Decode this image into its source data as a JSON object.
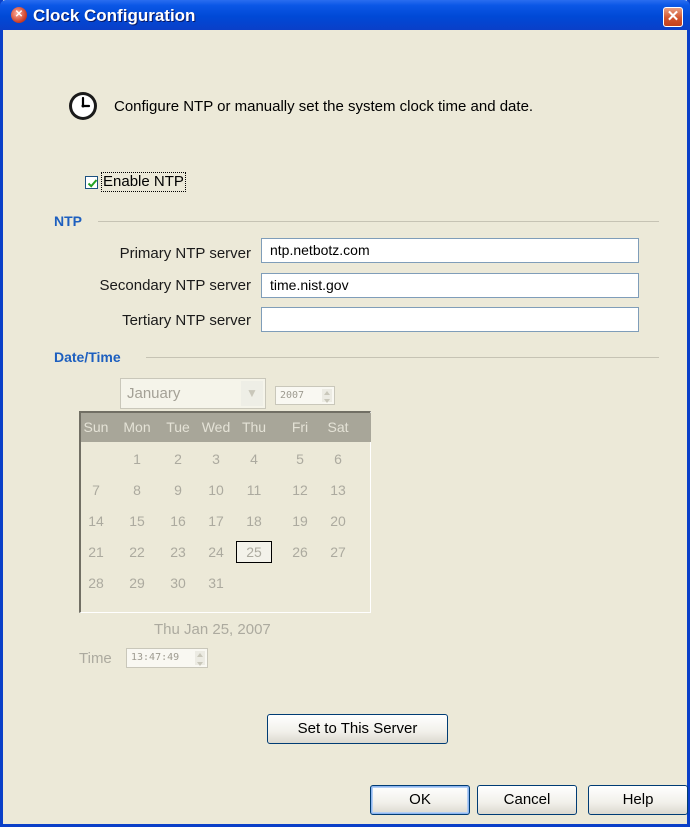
{
  "window": {
    "title": "Clock Configuration",
    "close_glyph": "✕",
    "app_icon": "netbotz-app-icon"
  },
  "intro": {
    "icon": "clock-icon",
    "text": "Configure NTP or manually set the system clock time and date."
  },
  "enable_ntp": {
    "label": "Enable NTP",
    "checked": true
  },
  "ntp": {
    "section_title": "NTP",
    "fields": [
      {
        "label": "Primary NTP server",
        "value": "ntp.netbotz.com"
      },
      {
        "label": "Secondary NTP server",
        "value": "time.nist.gov"
      },
      {
        "label": "Tertiary NTP server",
        "value": ""
      }
    ]
  },
  "datetime": {
    "section_title": "Date/Time",
    "month": "January",
    "year": "2007",
    "weekdays": [
      "Sun",
      "Mon",
      "Tue",
      "Wed",
      "Thu",
      "Fri",
      "Sat"
    ],
    "weeks": [
      [
        "",
        "1",
        "2",
        "3",
        "4",
        "5",
        "6"
      ],
      [
        "7",
        "8",
        "9",
        "10",
        "11",
        "12",
        "13"
      ],
      [
        "14",
        "15",
        "16",
        "17",
        "18",
        "19",
        "20"
      ],
      [
        "21",
        "22",
        "23",
        "24",
        "25",
        "26",
        "27"
      ],
      [
        "28",
        "29",
        "30",
        "31",
        "",
        "",
        ""
      ]
    ],
    "selected_day": "25",
    "date_caption": "Thu Jan 25, 2007",
    "time_label": "Time",
    "time_value": "13:47:49",
    "enabled": false,
    "disabled_color": "#acaa9f"
  },
  "buttons": {
    "set_server": "Set to This Server",
    "ok": "OK",
    "cancel": "Cancel",
    "help": "Help"
  },
  "colors": {
    "titlebar": "#0049d6",
    "dialog_bg": "#ece9d8",
    "section_title": "#1d5fbf"
  }
}
